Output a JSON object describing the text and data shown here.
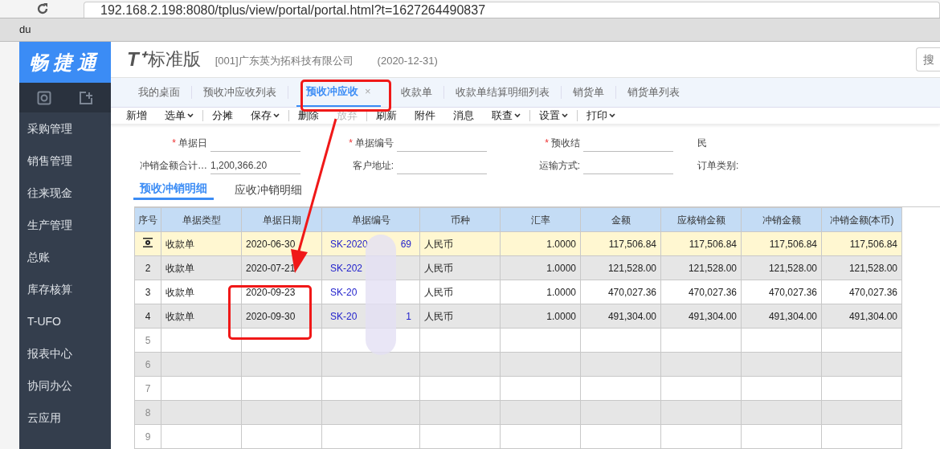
{
  "browser": {
    "url": "192.168.2.198:8080/tplus/view/portal/portal.html?t=1627264490837",
    "bookmark": "du"
  },
  "logo": "畅捷通",
  "header": {
    "product_mark": "T⁺",
    "product": "标准版",
    "company": "[001]广东英为拓科技有限公司",
    "date": "(2020-12-31)",
    "search_placeholder": "搜"
  },
  "sidebar": {
    "items": [
      "采购管理",
      "销售管理",
      "往来现金",
      "生产管理",
      "总账",
      "库存核算",
      "T-UFO",
      "报表中心",
      "协同办公",
      "云应用"
    ]
  },
  "tabs": [
    {
      "label": "我的桌面",
      "selected": false
    },
    {
      "label": "预收冲应收列表",
      "selected": false
    },
    {
      "label": "预收冲应收",
      "selected": true,
      "close": "×"
    },
    {
      "label": "收款单",
      "selected": false
    },
    {
      "label": "收款单结算明细列表",
      "selected": false
    },
    {
      "label": "销货单",
      "selected": false
    },
    {
      "label": "销货单列表",
      "selected": false
    }
  ],
  "toolbar": [
    {
      "label": "新增",
      "dropdown": false,
      "disabled": false
    },
    {
      "label": "选单",
      "dropdown": true,
      "disabled": false
    },
    {
      "label": "分摊",
      "dropdown": false,
      "disabled": false
    },
    {
      "label": "保存",
      "dropdown": true,
      "disabled": false
    },
    {
      "label": "删除",
      "dropdown": false,
      "disabled": false
    },
    {
      "label": "放弃",
      "dropdown": false,
      "disabled": true
    },
    {
      "label": "刷新",
      "dropdown": false,
      "disabled": false
    },
    {
      "label": "附件",
      "dropdown": false,
      "disabled": false
    },
    {
      "label": "消息",
      "dropdown": false,
      "disabled": false
    },
    {
      "label": "联查",
      "dropdown": true,
      "disabled": false
    },
    {
      "label": "设置",
      "dropdown": true,
      "disabled": false
    },
    {
      "label": "打印",
      "dropdown": true,
      "disabled": false
    }
  ],
  "form": [
    [
      {
        "label": "单据日",
        "marker": "*"
      },
      {
        "label": "单据编号",
        "marker": "*"
      },
      {
        "label": "预收结",
        "marker": "*"
      },
      {
        "label": "民"
      }
    ],
    [
      {
        "label": "冲销金额合计…",
        "value": "1,200,366.20"
      },
      {
        "label": "客户地址:"
      },
      {
        "label": "运输方式:"
      },
      {
        "label": "订单类别:"
      }
    ]
  ],
  "subtabs": [
    {
      "label": "预收冲销明细",
      "selected": true
    },
    {
      "label": "应收冲销明细",
      "selected": false
    }
  ],
  "table": {
    "columns": [
      "序号",
      "单据类型",
      "单据日期",
      "单据编号",
      "币种",
      "汇率",
      "金额",
      "应核销金额",
      "冲销金额",
      "冲销金额(本币)"
    ],
    "rows": [
      {
        "kind": "current",
        "selected": true,
        "no": "",
        "cells": [
          "收款单",
          "2020-06-30",
          "SK-2020",
          "69",
          "人民币",
          "1.0000",
          "117,506.84",
          "117,506.84",
          "117,506.84",
          "117,506.84"
        ]
      },
      {
        "kind": "data",
        "selected": false,
        "no": "2",
        "cells": [
          "收款单",
          "2020-07-21",
          "SK-202",
          "",
          "人民币",
          "1.0000",
          "121,528.00",
          "121,528.00",
          "121,528.00",
          "121,528.00"
        ]
      },
      {
        "kind": "data",
        "selected": false,
        "no": "3",
        "cells": [
          "收款单",
          "2020-09-23",
          "SK-20",
          "",
          "人民币",
          "1.0000",
          "470,027.36",
          "470,027.36",
          "470,027.36",
          "470,027.36"
        ]
      },
      {
        "kind": "data",
        "selected": false,
        "no": "4",
        "cells": [
          "收款单",
          "2020-09-30",
          "SK-20",
          "1",
          "人民币",
          "1.0000",
          "491,304.00",
          "491,304.00",
          "491,304.00",
          "491,304.00"
        ]
      },
      {
        "kind": "empty",
        "selected": false,
        "no": "5"
      },
      {
        "kind": "empty",
        "selected": false,
        "no": "6"
      },
      {
        "kind": "empty",
        "selected": false,
        "no": "7"
      },
      {
        "kind": "empty",
        "selected": false,
        "no": "8"
      },
      {
        "kind": "empty",
        "selected": false,
        "no": "9"
      }
    ]
  }
}
